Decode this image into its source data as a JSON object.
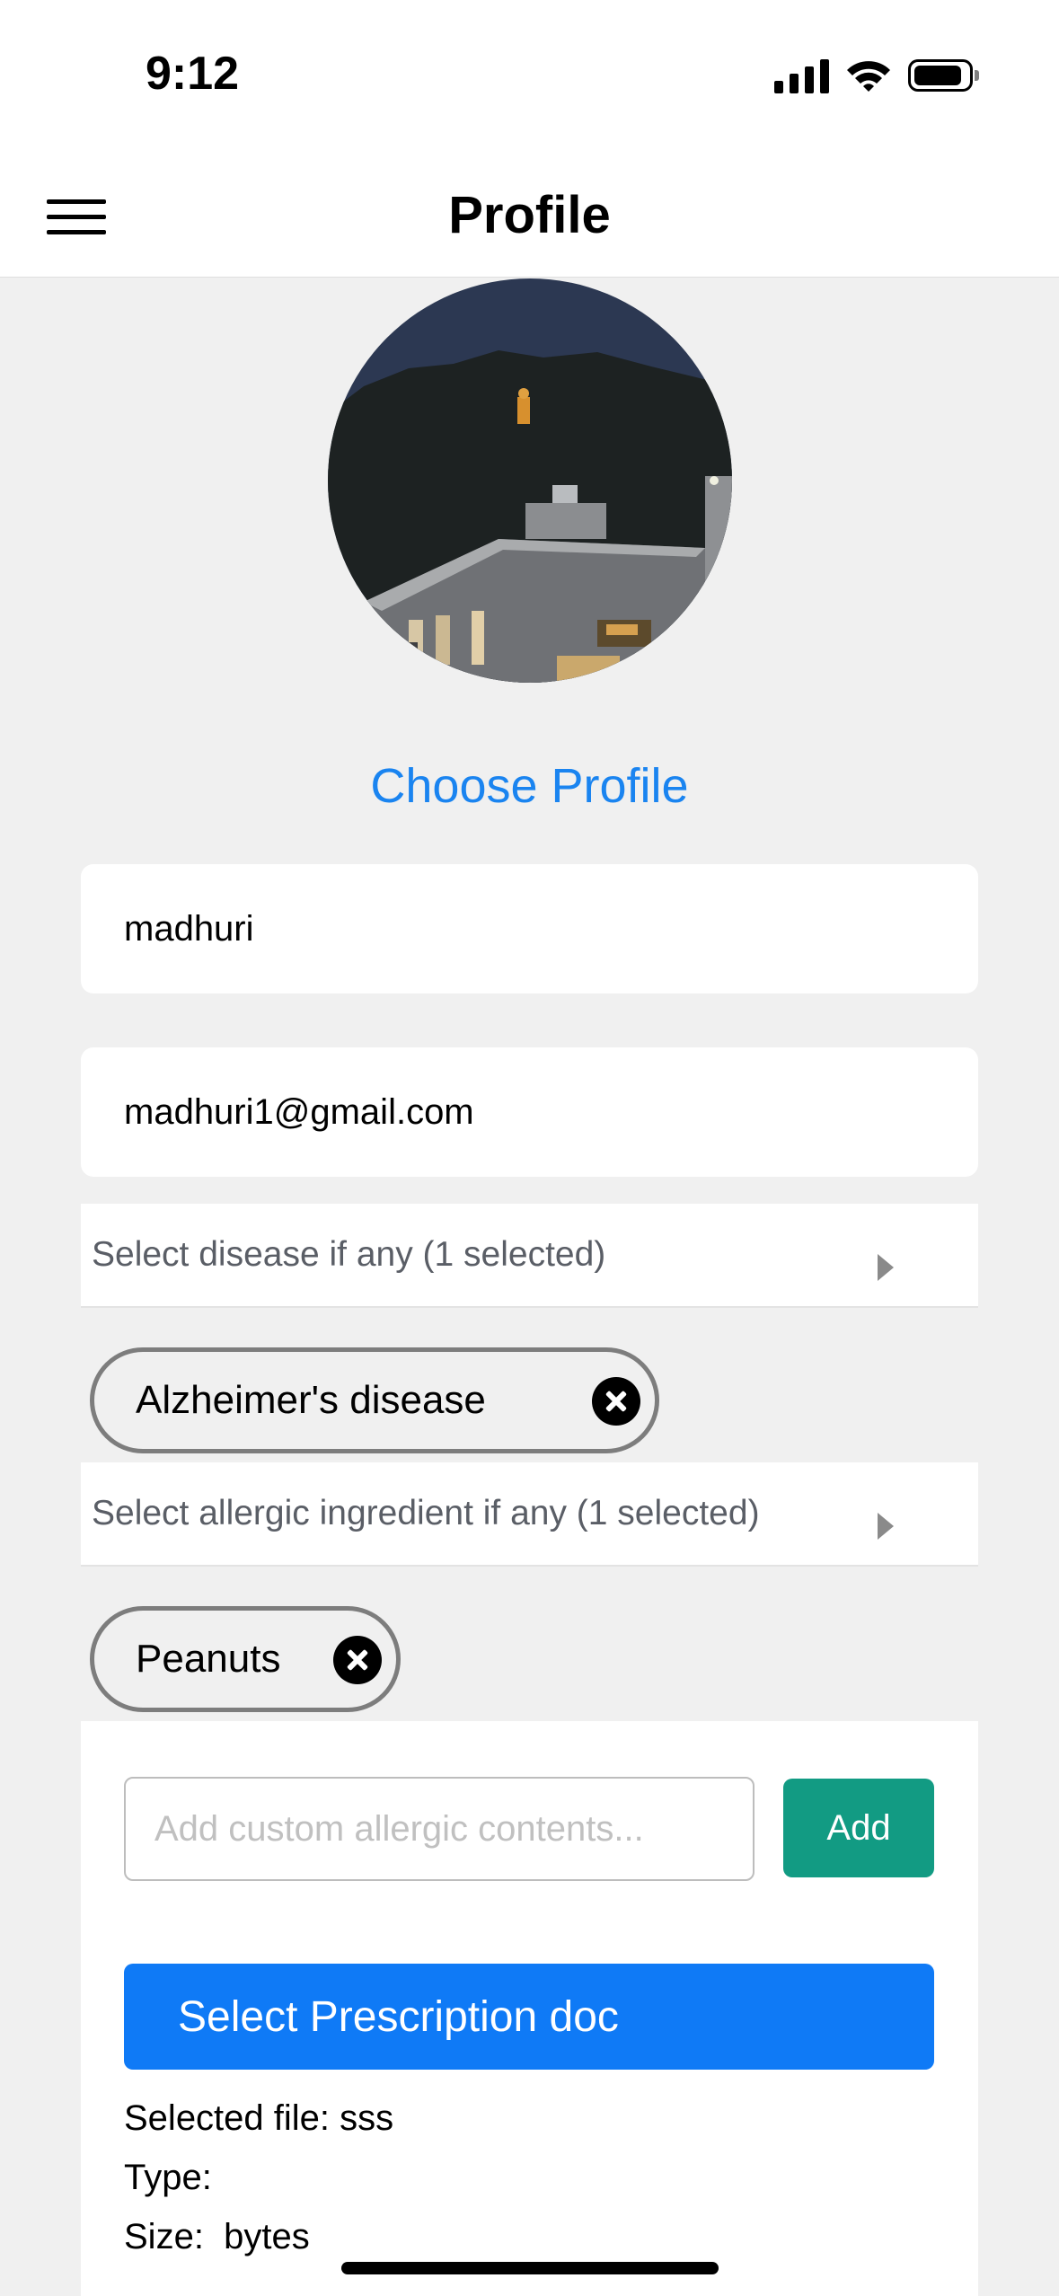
{
  "status_bar": {
    "time": "9:12"
  },
  "nav": {
    "title": "Profile"
  },
  "profile": {
    "choose_label": "Choose Profile"
  },
  "form": {
    "name_value": "madhuri",
    "email_value": "madhuri1@gmail.com",
    "disease_dropdown_label": "Select disease if any (1 selected)",
    "disease_chips": [
      "Alzheimer's disease"
    ],
    "allergen_dropdown_label": "Select allergic ingredient if any (1 selected)",
    "allergen_chips": [
      "Peanuts"
    ],
    "custom_allergen_placeholder": "Add custom allergic contents...",
    "add_label": "Add",
    "prescription_button_label": "Select Prescription doc",
    "selected_file_line": "Selected file: sss",
    "type_line": "Type:",
    "size_line": "Size:  bytes"
  },
  "colors": {
    "link_blue": "#1a84f0",
    "add_green": "#129b83",
    "primary_blue": "#0f7af6",
    "background": "#f0f0f0"
  },
  "icons": [
    "menu-icon",
    "cellular-signal-icon",
    "wifi-icon",
    "battery-icon",
    "close-circle-icon",
    "caret-right-icon"
  ]
}
